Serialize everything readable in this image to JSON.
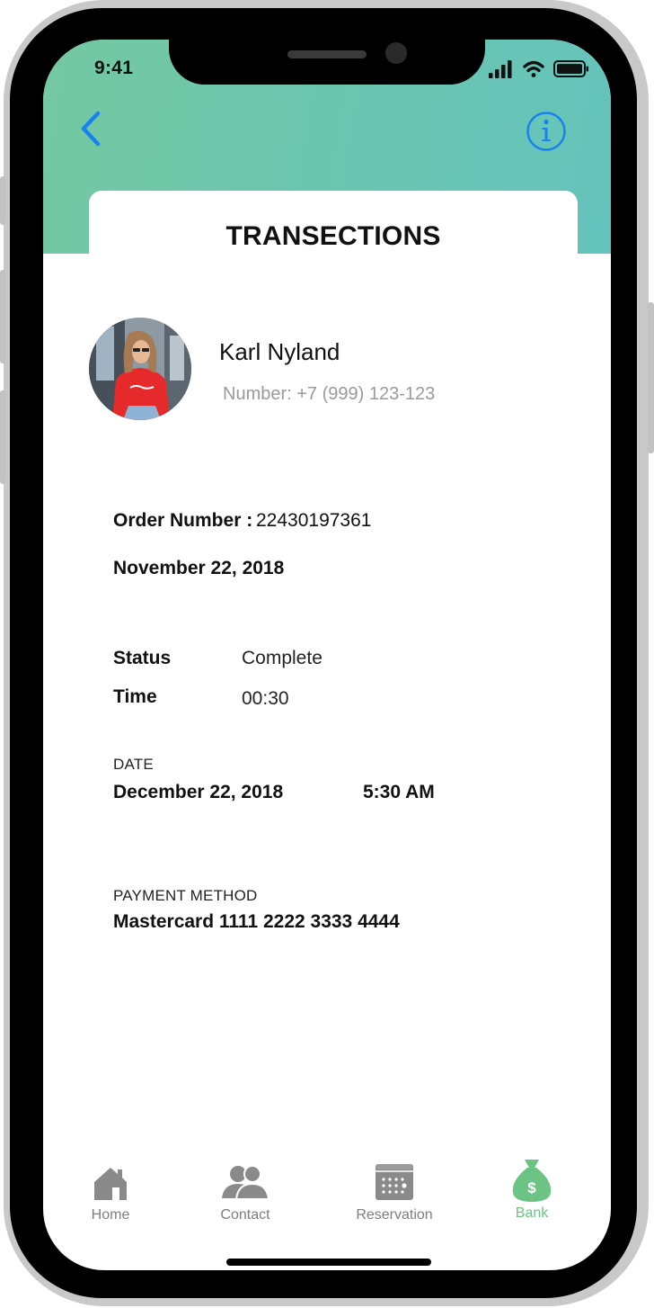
{
  "status_bar": {
    "time": "9:41"
  },
  "header": {
    "title": "TRANSECTIONS"
  },
  "user": {
    "name": "Karl Nyland",
    "number": "Number: +7 (999) 123-123"
  },
  "order": {
    "number_label": "Order Number :",
    "number_value": "22430197361",
    "date": "November  22,  2018"
  },
  "details": {
    "status_label": "Status",
    "status_value": "Complete",
    "time_label": "Time",
    "time_value": "00:30"
  },
  "date_section": {
    "label": "DATE",
    "date": "December  22,  2018",
    "time": "5:30 AM"
  },
  "payment": {
    "label": "PAYMENT METHOD",
    "method": "Mastercard  1111 2222 3333 4444"
  },
  "tab_bar": {
    "items": [
      {
        "label": "Home",
        "icon": "home-icon"
      },
      {
        "label": "Contact",
        "icon": "contacts-icon"
      },
      {
        "label": "Reservation",
        "icon": "calendar-icon"
      },
      {
        "label": "Bank",
        "icon": "money-bag-icon"
      }
    ],
    "active_index": 3
  },
  "colors": {
    "header_start": "#74c8a2",
    "header_end": "#64c3bc",
    "accent_blue": "#1a82ef",
    "active_tab": "#6cc384",
    "inactive_tab": "#8a8a8a"
  }
}
